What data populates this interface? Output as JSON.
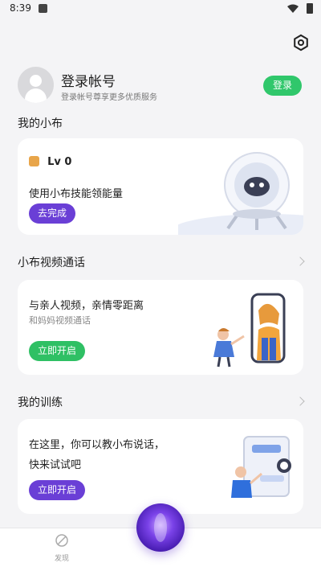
{
  "status_bar": {
    "time": "8:39"
  },
  "profile": {
    "title": "登录帐号",
    "subtitle": "登录帐号尊享更多优质服务",
    "login_button": "登录"
  },
  "section_my_xiaobu": {
    "title": "我的小布",
    "level": "Lv 0",
    "text": "使用小布技能领能量",
    "button": "去完成"
  },
  "section_video_call": {
    "title": "小布视频通话",
    "text": "与亲人视频，亲情零距离",
    "subtext": "和妈妈视频通话",
    "button": "立即开启"
  },
  "section_training": {
    "title": "我的训练",
    "text_line1": "在这里，你可以教小布说话，",
    "text_line2": "快来试试吧",
    "button": "立即开启"
  },
  "tabbar": {
    "discover_label": "发现"
  },
  "colors": {
    "accent_purple": "#6a3fd6",
    "accent_green": "#2fc064"
  }
}
